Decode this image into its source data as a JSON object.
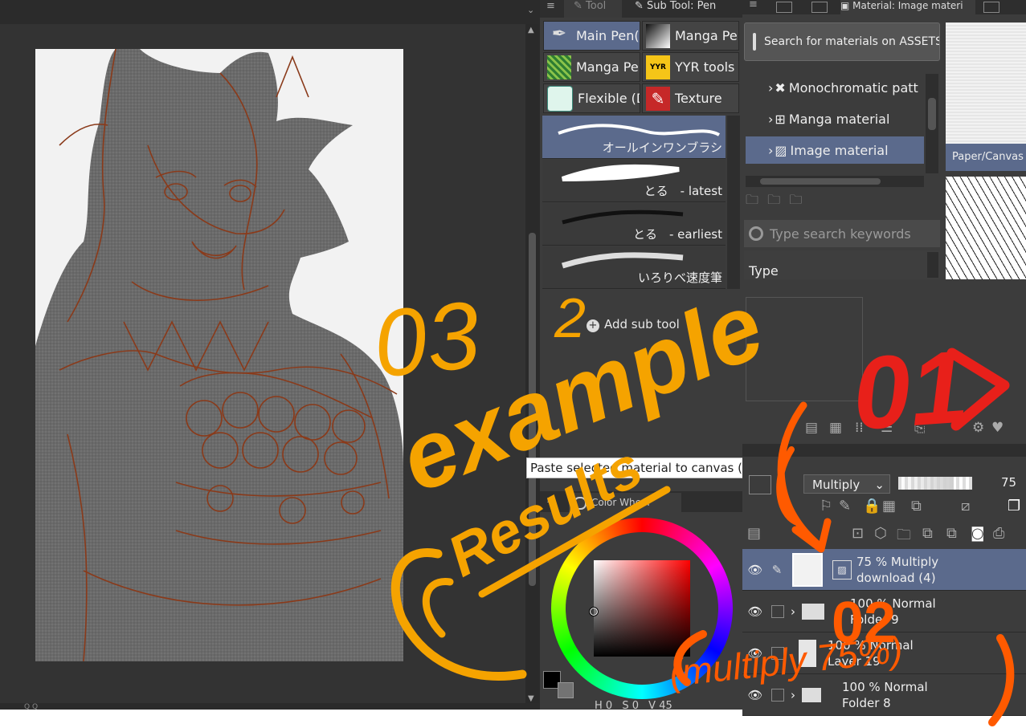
{
  "tool_panel": {
    "tab_tool": "Tool",
    "tab_sub_tool": "Sub Tool: Pen",
    "groups": [
      "Main Pen(",
      "Manga Pe",
      "Manga Pe",
      "YYR tools",
      "Flexible (D",
      "Texture"
    ],
    "yyr_badge": "YYR",
    "brushes": [
      "オールインワンブラシ",
      "とる　- latest",
      "とる　- earliest",
      "いろりべ速度筆"
    ],
    "add_sub_tool": "Add sub tool"
  },
  "material_panel": {
    "tab_title": "Material: Image materi",
    "search_assets": "Search for materials on ASSETS",
    "tree": [
      "Monochromatic patt",
      "Manga material",
      "Image material"
    ],
    "search_placeholder": "Type search keywords",
    "type_label": "Type",
    "thumb_label": "Paper/Canvas"
  },
  "tooltip": "Paste selected material to canvas (register setting material to palette and prese",
  "layer_panel": {
    "blend_mode": "Multiply",
    "opacity_value": "75",
    "layers": [
      {
        "line1": "75 % Multiply",
        "line2": "download (4)"
      },
      {
        "line1": "100 % Normal",
        "line2": "Folder 9"
      },
      {
        "line1": "100 % Normal",
        "line2": "Layer 19"
      },
      {
        "line1": "100 % Normal",
        "line2": "Folder 8"
      }
    ]
  },
  "color_panel": {
    "tab_label": "Color Wheel",
    "readout": {
      "h_label": "H",
      "h": "0",
      "s_label": "S",
      "s": "0",
      "v_label": "V",
      "v": "45"
    }
  },
  "status": {
    "bottom_left": "Q  Q"
  },
  "annotations": {
    "a03": "03",
    "a03_sup": "2",
    "example": "example",
    "results": "Results",
    "a01": "01",
    "a02": "02",
    "multiply": "(multiply 75%)"
  },
  "colors": {
    "annotation_orange": "#F5A300",
    "annotation_red": "#E8201A",
    "annotation_deep_orange": "#FF5A00",
    "line_art": "#8a3a1a",
    "selection_blue": "#5b6a8c"
  }
}
